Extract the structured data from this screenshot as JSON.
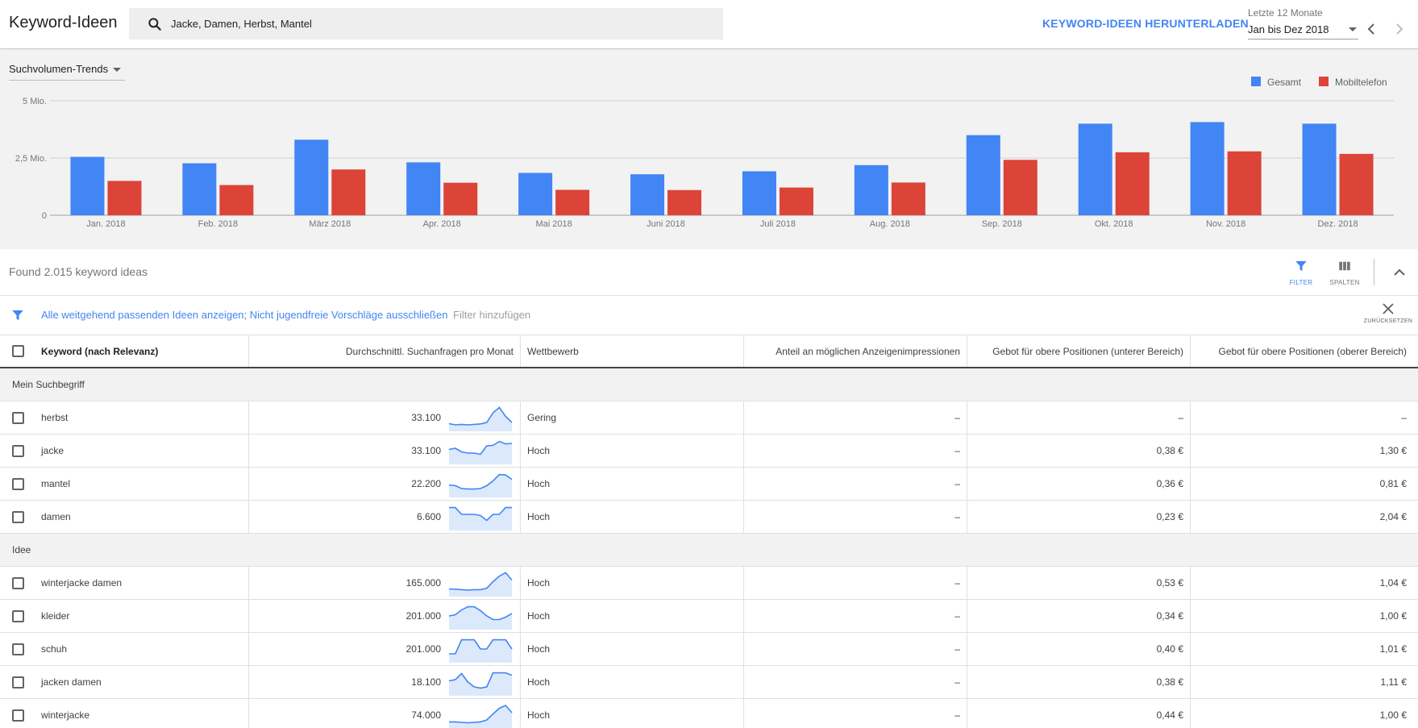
{
  "header": {
    "title": "Keyword-Ideen",
    "search_value": "Jacke, Damen, Herbst, Mantel",
    "download_label": "KEYWORD-IDEEN HERUNTERLADEN",
    "date_range_label": "Letzte 12 Monate",
    "date_range_value": "Jan bis Dez 2018"
  },
  "chart_panel": {
    "trend_select": "Suchvolumen-Trends"
  },
  "chart_data": {
    "type": "bar",
    "categories": [
      "Jan. 2018",
      "Feb. 2018",
      "März 2018",
      "Apr. 2018",
      "Mai 2018",
      "Juni 2018",
      "Juli 2018",
      "Aug. 2018",
      "Sep. 2018",
      "Okt. 2018",
      "Nov. 2018",
      "Dez. 2018"
    ],
    "series": [
      {
        "name": "Gesamt",
        "color": "#4285f4",
        "values": [
          2550000,
          2270000,
          3300000,
          2310000,
          1850000,
          1790000,
          1920000,
          2190000,
          3500000,
          4000000,
          4070000,
          4000000
        ]
      },
      {
        "name": "Mobiltelefon",
        "color": "#db4437",
        "values": [
          1500000,
          1320000,
          2000000,
          1420000,
          1110000,
          1100000,
          1210000,
          1430000,
          2420000,
          2750000,
          2790000,
          2680000
        ]
      }
    ],
    "yticks": [
      {
        "value": 0,
        "label": "0"
      },
      {
        "value": 2500000,
        "label": "2,5 Mio."
      },
      {
        "value": 5000000,
        "label": "5 Mio."
      }
    ],
    "ylim": [
      0,
      5000000
    ],
    "grid": true,
    "legend": "top-right"
  },
  "summary": {
    "found_text": "Found 2.015 keyword ideas",
    "filter_label": "FILTER",
    "columns_label": "SPALTEN"
  },
  "filter_bar": {
    "active_filters": "Alle weitgehend passenden Ideen anzeigen; Nicht jugendfreie Vorschläge ausschließen",
    "add_filter": "Filter hinzufügen",
    "reset_label": "ZURÜCKSETZEN"
  },
  "table": {
    "columns": [
      "Keyword (nach Relevanz)",
      "Durchschnittl. Suchanfragen pro Monat",
      "Wettbewerb",
      "Anteil an möglichen Anzeigenimpressionen",
      "Gebot für obere Positionen (unterer Bereich)",
      "Gebot für obere Positionen (oberer Bereich)"
    ],
    "groups": [
      {
        "label": "Mein Suchbegriff",
        "rows": [
          {
            "keyword": "herbst",
            "volume": "33.100",
            "competition": "Gering",
            "impression_share": "–",
            "bid_low": "–",
            "bid_high": "–",
            "trend": [
              0.25,
              0.2,
              0.22,
              0.2,
              0.22,
              0.24,
              0.3,
              0.7,
              0.92,
              0.55,
              0.3
            ]
          },
          {
            "keyword": "jacke",
            "volume": "33.100",
            "competition": "Hoch",
            "impression_share": "–",
            "bid_low": "0,38 €",
            "bid_high": "1,30 €",
            "trend": [
              0.55,
              0.6,
              0.45,
              0.4,
              0.4,
              0.35,
              0.7,
              0.72,
              0.88,
              0.78,
              0.8
            ]
          },
          {
            "keyword": "mantel",
            "volume": "22.200",
            "competition": "Hoch",
            "impression_share": "–",
            "bid_low": "0,36 €",
            "bid_high": "0,81 €",
            "trend": [
              0.45,
              0.42,
              0.3,
              0.28,
              0.28,
              0.3,
              0.42,
              0.62,
              0.88,
              0.86,
              0.68
            ]
          },
          {
            "keyword": "damen",
            "volume": "6.600",
            "competition": "Hoch",
            "impression_share": "–",
            "bid_low": "0,23 €",
            "bid_high": "2,04 €",
            "trend": [
              0.88,
              0.88,
              0.6,
              0.6,
              0.6,
              0.55,
              0.35,
              0.6,
              0.6,
              0.88,
              0.88
            ]
          }
        ]
      },
      {
        "label": "Idee",
        "rows": [
          {
            "keyword": "winterjacke damen",
            "volume": "165.000",
            "competition": "Hoch",
            "impression_share": "–",
            "bid_low": "0,53 €",
            "bid_high": "1,04 €",
            "trend": [
              0.25,
              0.24,
              0.22,
              0.2,
              0.22,
              0.22,
              0.28,
              0.55,
              0.78,
              0.92,
              0.62
            ]
          },
          {
            "keyword": "kleider",
            "volume": "201.000",
            "competition": "Hoch",
            "impression_share": "–",
            "bid_low": "0,34 €",
            "bid_high": "1,00 €",
            "trend": [
              0.5,
              0.55,
              0.75,
              0.88,
              0.88,
              0.72,
              0.5,
              0.35,
              0.35,
              0.45,
              0.6
            ]
          },
          {
            "keyword": "schuh",
            "volume": "201.000",
            "competition": "Hoch",
            "impression_share": "–",
            "bid_low": "0,40 €",
            "bid_high": "1,01 €",
            "trend": [
              0.3,
              0.3,
              0.88,
              0.88,
              0.88,
              0.5,
              0.5,
              0.88,
              0.88,
              0.88,
              0.5
            ]
          },
          {
            "keyword": "jacken damen",
            "volume": "18.100",
            "competition": "Hoch",
            "impression_share": "–",
            "bid_low": "0,38 €",
            "bid_high": "1,11 €",
            "trend": [
              0.55,
              0.6,
              0.85,
              0.5,
              0.3,
              0.25,
              0.3,
              0.88,
              0.88,
              0.88,
              0.78
            ]
          },
          {
            "keyword": "winterjacke",
            "volume": "74.000",
            "competition": "Hoch",
            "impression_share": "–",
            "bid_low": "0,44 €",
            "bid_high": "1,00 €",
            "trend": [
              0.22,
              0.22,
              0.2,
              0.18,
              0.2,
              0.22,
              0.3,
              0.55,
              0.78,
              0.9,
              0.6
            ]
          }
        ]
      }
    ]
  }
}
